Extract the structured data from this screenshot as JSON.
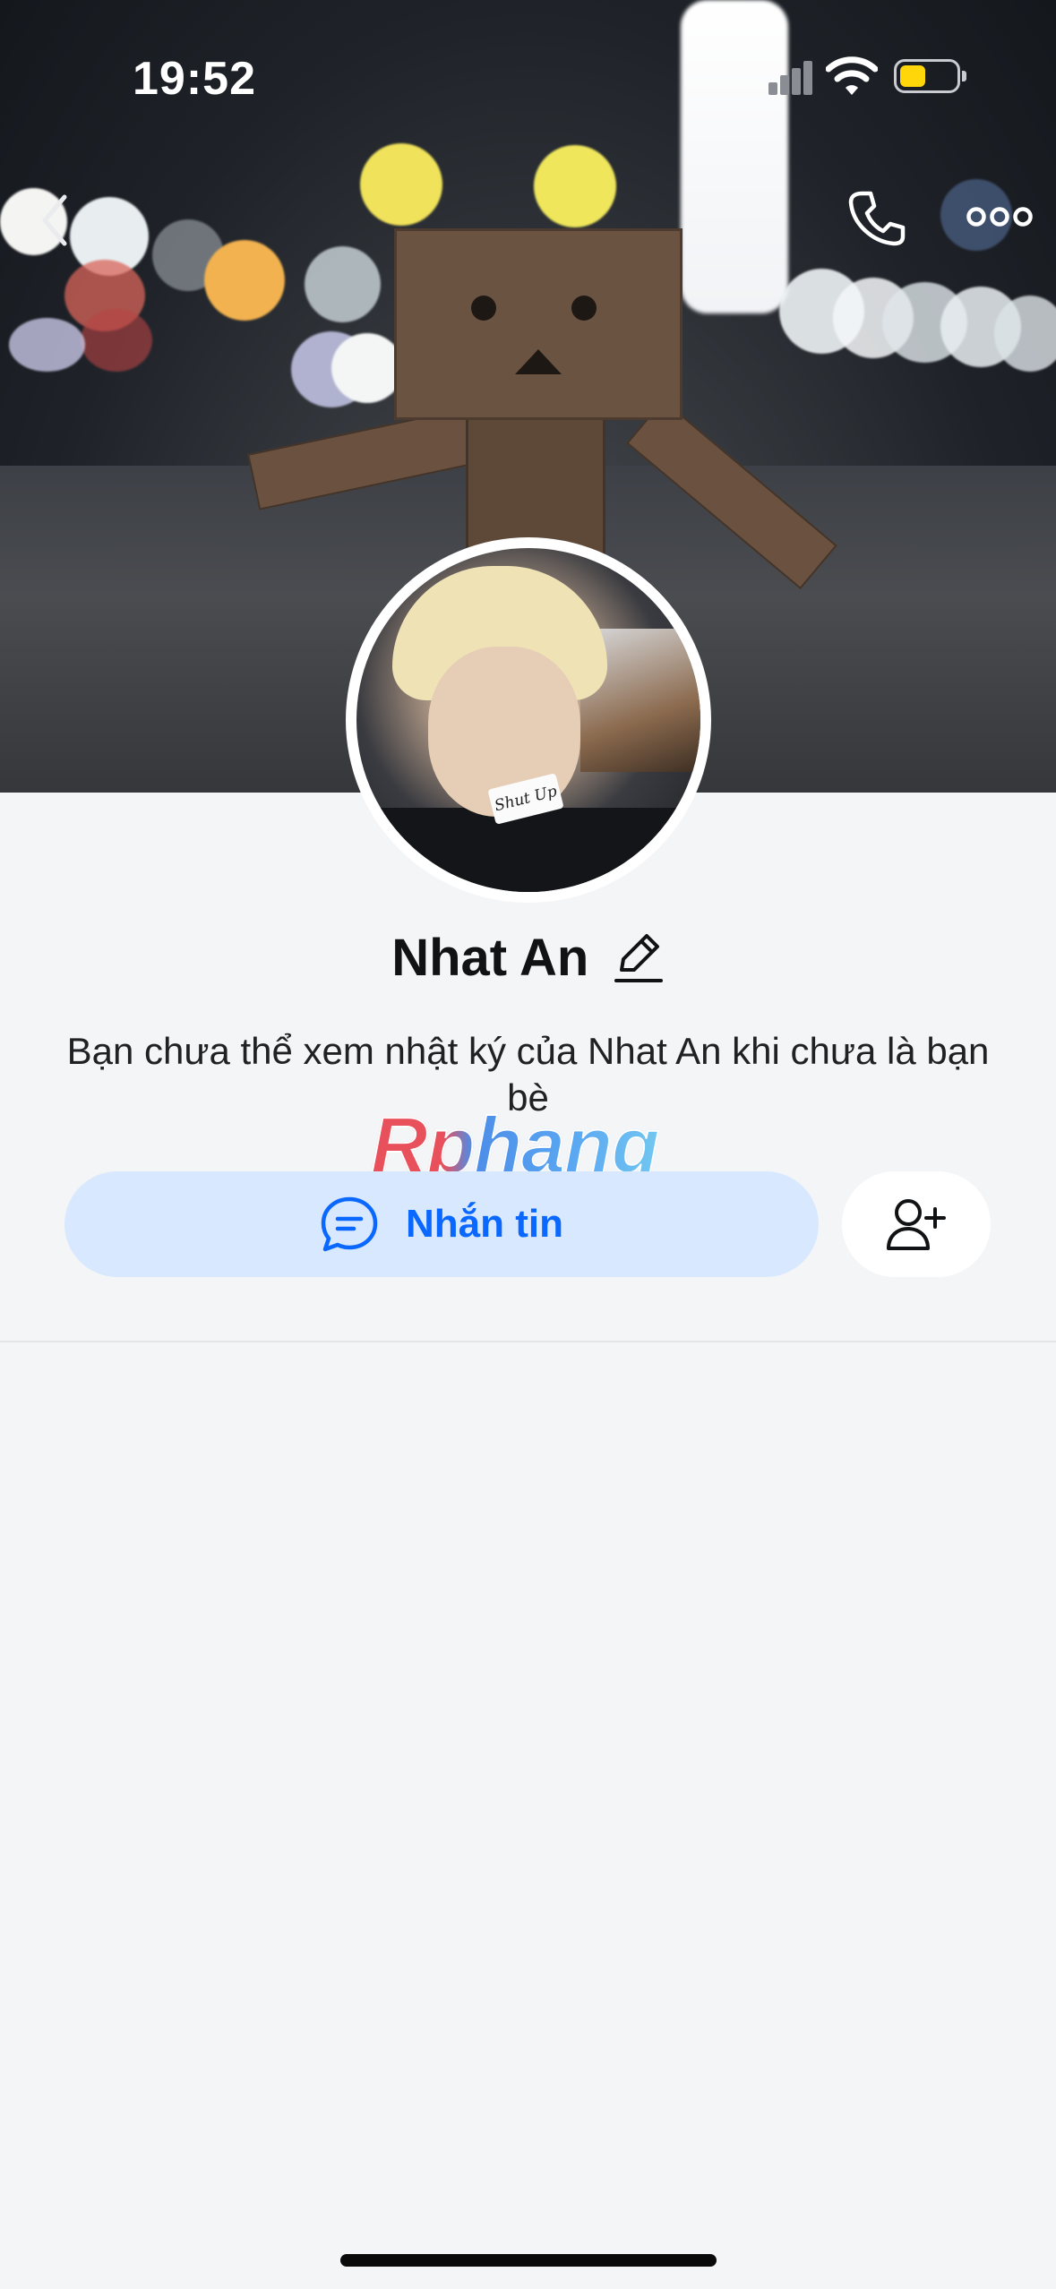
{
  "status_bar": {
    "time": "19:52"
  },
  "profile": {
    "name": "Nhat An",
    "notice": "Bạn chưa thể xem nhật ký của Nhat An khi chưa là bạn bè"
  },
  "actions": {
    "message_label": "Nhắn tin"
  },
  "watermark": {
    "text": "Rphang"
  },
  "icons": {
    "back": "chevron-left-icon",
    "call": "phone-icon",
    "more": "more-horizontal-icon",
    "edit": "pencil-icon",
    "message": "chat-bubble-icon",
    "add_friend": "add-friend-icon"
  },
  "colors": {
    "accent": "#0a68ff",
    "message_button_bg": "#d8e8fe",
    "battery": "#ffd60a",
    "background": "#f4f5f7"
  }
}
